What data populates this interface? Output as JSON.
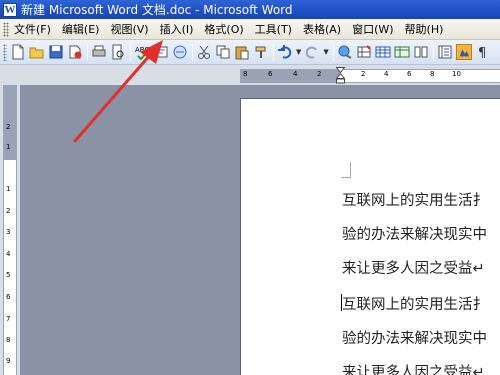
{
  "window": {
    "title": "新建 Microsoft Word 文档.doc - Microsoft Word",
    "app_icon_letter": "W"
  },
  "menu": {
    "items": [
      {
        "id": "file",
        "label": "文件(F)"
      },
      {
        "id": "edit",
        "label": "编辑(E)"
      },
      {
        "id": "view",
        "label": "视图(V)"
      },
      {
        "id": "insert",
        "label": "插入(I)"
      },
      {
        "id": "format",
        "label": "格式(O)"
      },
      {
        "id": "tools",
        "label": "工具(T)"
      },
      {
        "id": "table",
        "label": "表格(A)"
      },
      {
        "id": "window",
        "label": "窗口(W)"
      },
      {
        "id": "help",
        "label": "帮助(H)"
      }
    ]
  },
  "ruler": {
    "horizontal_ticks": [
      "8",
      "6",
      "4",
      "2",
      "2",
      "4",
      "6",
      "8",
      "10"
    ],
    "vertical_ticks": [
      "2",
      "1",
      "1",
      "2",
      "3",
      "4",
      "5",
      "6",
      "7",
      "8",
      "9",
      "10"
    ]
  },
  "document": {
    "lines": [
      "互联网上的实用生活扌",
      "验的办法来解决现实中",
      "来让更多人因之受益↵",
      "互联网上的实用生活扌",
      "验的办法来解决现实中",
      "来让更多人因之受益↵"
    ]
  },
  "colors": {
    "titlebar": "#1e4fc4",
    "annotation_arrow": "#e0302a",
    "workspace": "#8a93a6"
  }
}
